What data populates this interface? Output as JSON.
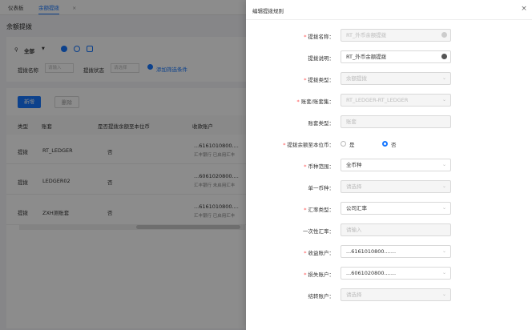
{
  "tabs": [
    {
      "label": "仪表板"
    },
    {
      "label": "余额提拨"
    }
  ],
  "page_title": "余额提拨",
  "filters": {
    "scope": "全部",
    "name_label": "提拨名称",
    "name_placeholder": "请输入",
    "status_label": "提拨状态",
    "status_placeholder": "请选择",
    "add_label": "添加筛选条件"
  },
  "toolbar": {
    "new_label": "新增",
    "delete_label": "删除"
  },
  "table": {
    "headers": [
      "类型",
      "账套",
      "是否提拨余额至本位币",
      "收款账户"
    ],
    "rows": [
      {
        "type": "提拨",
        "ledger": "RT_LEDGER",
        "flag": "否",
        "account": "...6161010800....",
        "account_sub": "汇丰银行 已启用汇丰"
      },
      {
        "type": "提拨",
        "ledger": "LEDGER02",
        "flag": "否",
        "account": "...6061020800....",
        "account_sub": "汇丰银行 未启用汇丰"
      },
      {
        "type": "提拨",
        "ledger": "ZXH测账套",
        "flag": "否",
        "account": "...6161010800....",
        "account_sub": "汇丰银行 已启用汇丰"
      }
    ]
  },
  "drawer": {
    "title": "编辑提拨规则",
    "close": "×",
    "fields": [
      {
        "label": "提拨名称：",
        "required": true,
        "value": "RT_外币余额提拨",
        "disabled": true,
        "icon": "gear-icon"
      },
      {
        "label": "提拨说明：",
        "required": false,
        "value": "RT_外币余额提拨",
        "disabled": false,
        "icon": "gear-icon"
      },
      {
        "label": "提拨类型：",
        "required": true,
        "value": "余额提拨",
        "disabled": true,
        "icon": "chevron-down-icon"
      },
      {
        "label": "账套/账套集：",
        "required": true,
        "value": "RT_LEDGER-RT_LEDGER",
        "disabled": true,
        "icon": "chevron-down-icon"
      },
      {
        "label": "账套类型：",
        "required": false,
        "value": "账套",
        "disabled": true,
        "icon": ""
      },
      {
        "label": "提拨余额至本位币：",
        "required": true,
        "type": "radio",
        "options": [
          "是",
          "否"
        ],
        "selected": 1
      },
      {
        "label": "币种范围：",
        "required": true,
        "value": "全币种",
        "disabled": false,
        "icon": "chevron-down-icon"
      },
      {
        "label": "单一币种：",
        "required": false,
        "value": "请选择",
        "disabled": true,
        "icon": "chevron-down-icon",
        "placeholder": true
      },
      {
        "label": "汇率类型：",
        "required": true,
        "value": "公司汇率",
        "disabled": false,
        "icon": "chevron-down-icon"
      },
      {
        "label": "一次性汇率：",
        "required": false,
        "value": "请输入",
        "disabled": true,
        "icon": "",
        "placeholder": true
      },
      {
        "label": "收益账户：",
        "required": true,
        "value": "...6161010800.......",
        "disabled": false,
        "icon": "chevron-down-icon"
      },
      {
        "label": "损失账户：",
        "required": true,
        "value": "...6061020800.......",
        "disabled": false,
        "icon": "chevron-down-icon"
      },
      {
        "label": "结转账户：",
        "required": false,
        "value": "请选择",
        "disabled": true,
        "icon": "chevron-down-icon",
        "placeholder": true
      }
    ]
  }
}
